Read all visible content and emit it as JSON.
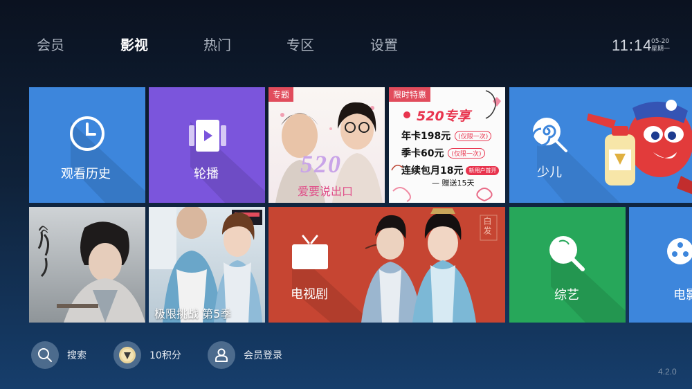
{
  "nav": {
    "items": [
      "会员",
      "影视",
      "热门",
      "专区",
      "设置"
    ],
    "active_index": 1,
    "time": "11:14",
    "date": "05-20",
    "weekday": "星期一"
  },
  "tiles": {
    "history": "观看历史",
    "carousel": "轮播",
    "special_badge": "专题",
    "special_text_520": "520",
    "special_caption": "爱要说出口",
    "deal_badge": "限时特惠",
    "deal_title": "520专享",
    "deal_line1": "年卡198元",
    "deal_line1_note": "(仅限一次)",
    "deal_line2": "季卡60元",
    "deal_line2_note": "(仅限一次)",
    "deal_line3": "连续包月18元",
    "deal_line3_note": "新用户首开",
    "deal_line4": "— 赠送15天",
    "kids": "少儿",
    "show_caption": "极限挑战 第5季",
    "tv_series": "电视剧",
    "tv_series_stamp": "白发",
    "variety": "综艺",
    "movie": "电影"
  },
  "bottom": {
    "search": "搜索",
    "points": "10积分",
    "login": "会员登录",
    "version": "4.2.0"
  }
}
